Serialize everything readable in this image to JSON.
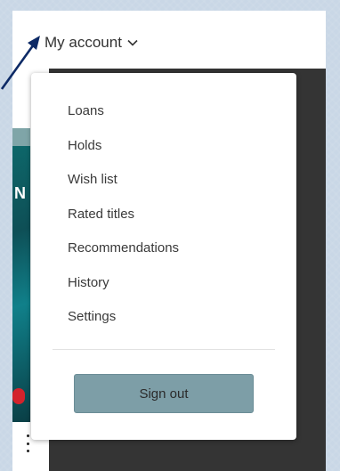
{
  "header": {
    "account_label": "My account"
  },
  "menu": {
    "items": [
      {
        "label": "Loans"
      },
      {
        "label": "Holds"
      },
      {
        "label": "Wish list"
      },
      {
        "label": "Rated titles"
      },
      {
        "label": "Recommendations"
      },
      {
        "label": "History"
      },
      {
        "label": "Settings"
      }
    ],
    "signout_label": "Sign out"
  },
  "cover": {
    "visible_letter": "N"
  },
  "colors": {
    "signout_button": "#7d9ea7",
    "annotation_arrow": "#0d2a66",
    "page_dark": "#343434"
  }
}
